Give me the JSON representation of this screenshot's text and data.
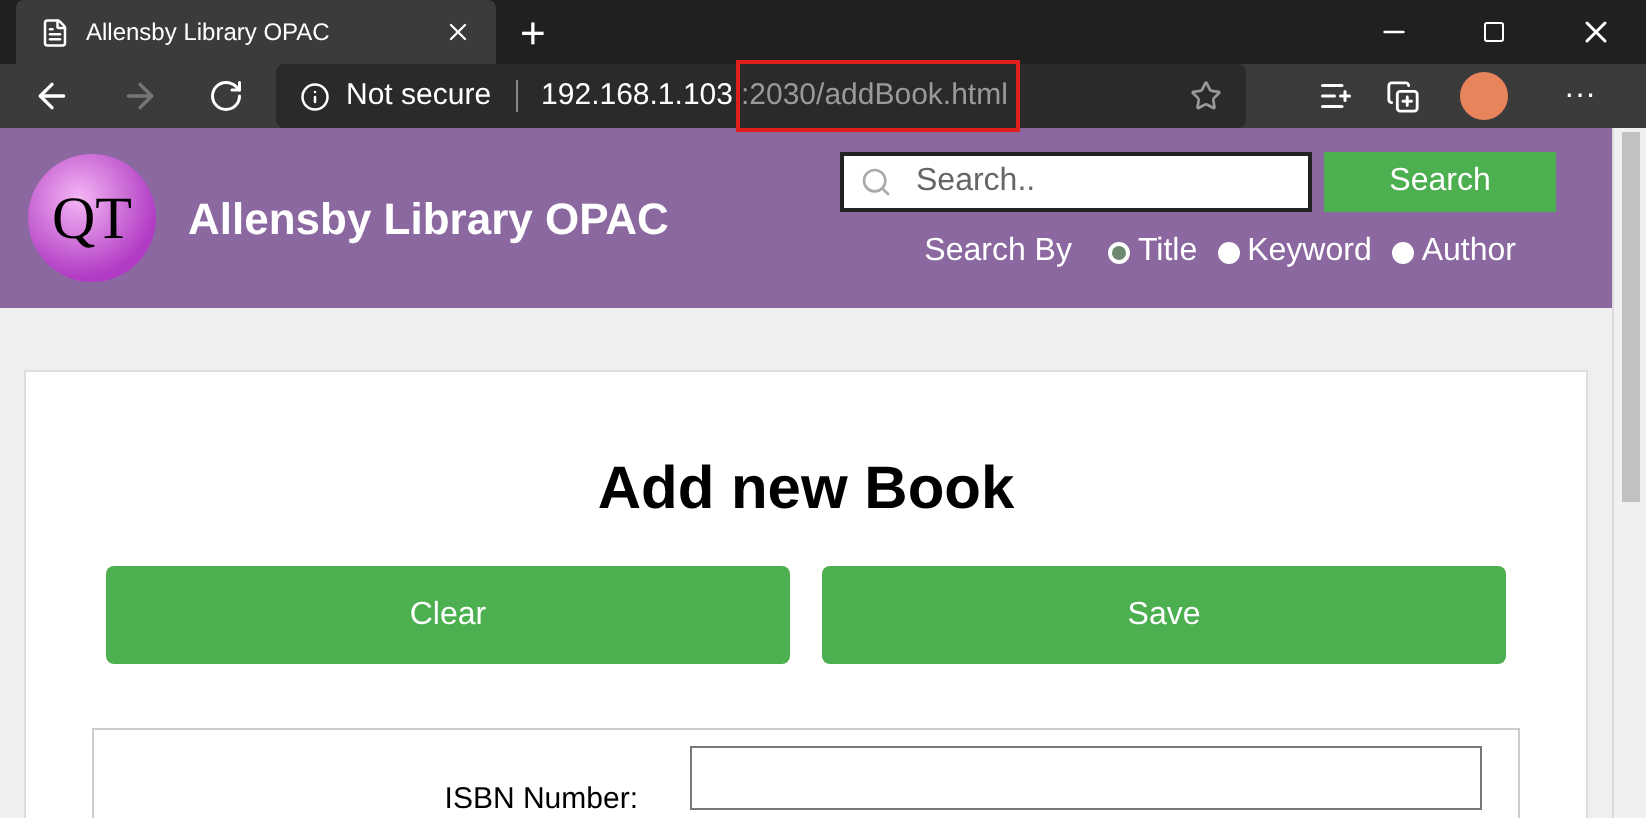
{
  "browser": {
    "tab_title": "Allensby Library OPAC",
    "new_tab": "+",
    "security": "Not secure",
    "url_host": "192.168.1.103",
    "url_rest": ":2030/addBook.html",
    "more": "···"
  },
  "header": {
    "logo_text": "QT",
    "site_title": "Allensby Library OPAC",
    "search_placeholder": "Search..",
    "search_button": "Search",
    "search_by_label": "Search By",
    "search_options": [
      {
        "label": "Title",
        "selected": true
      },
      {
        "label": "Keyword",
        "selected": false
      },
      {
        "label": "Author",
        "selected": false
      }
    ]
  },
  "page": {
    "heading": "Add new Book",
    "buttons": [
      "Clear",
      "Save"
    ],
    "fields": [
      {
        "label": "ISBN Number:"
      }
    ]
  }
}
